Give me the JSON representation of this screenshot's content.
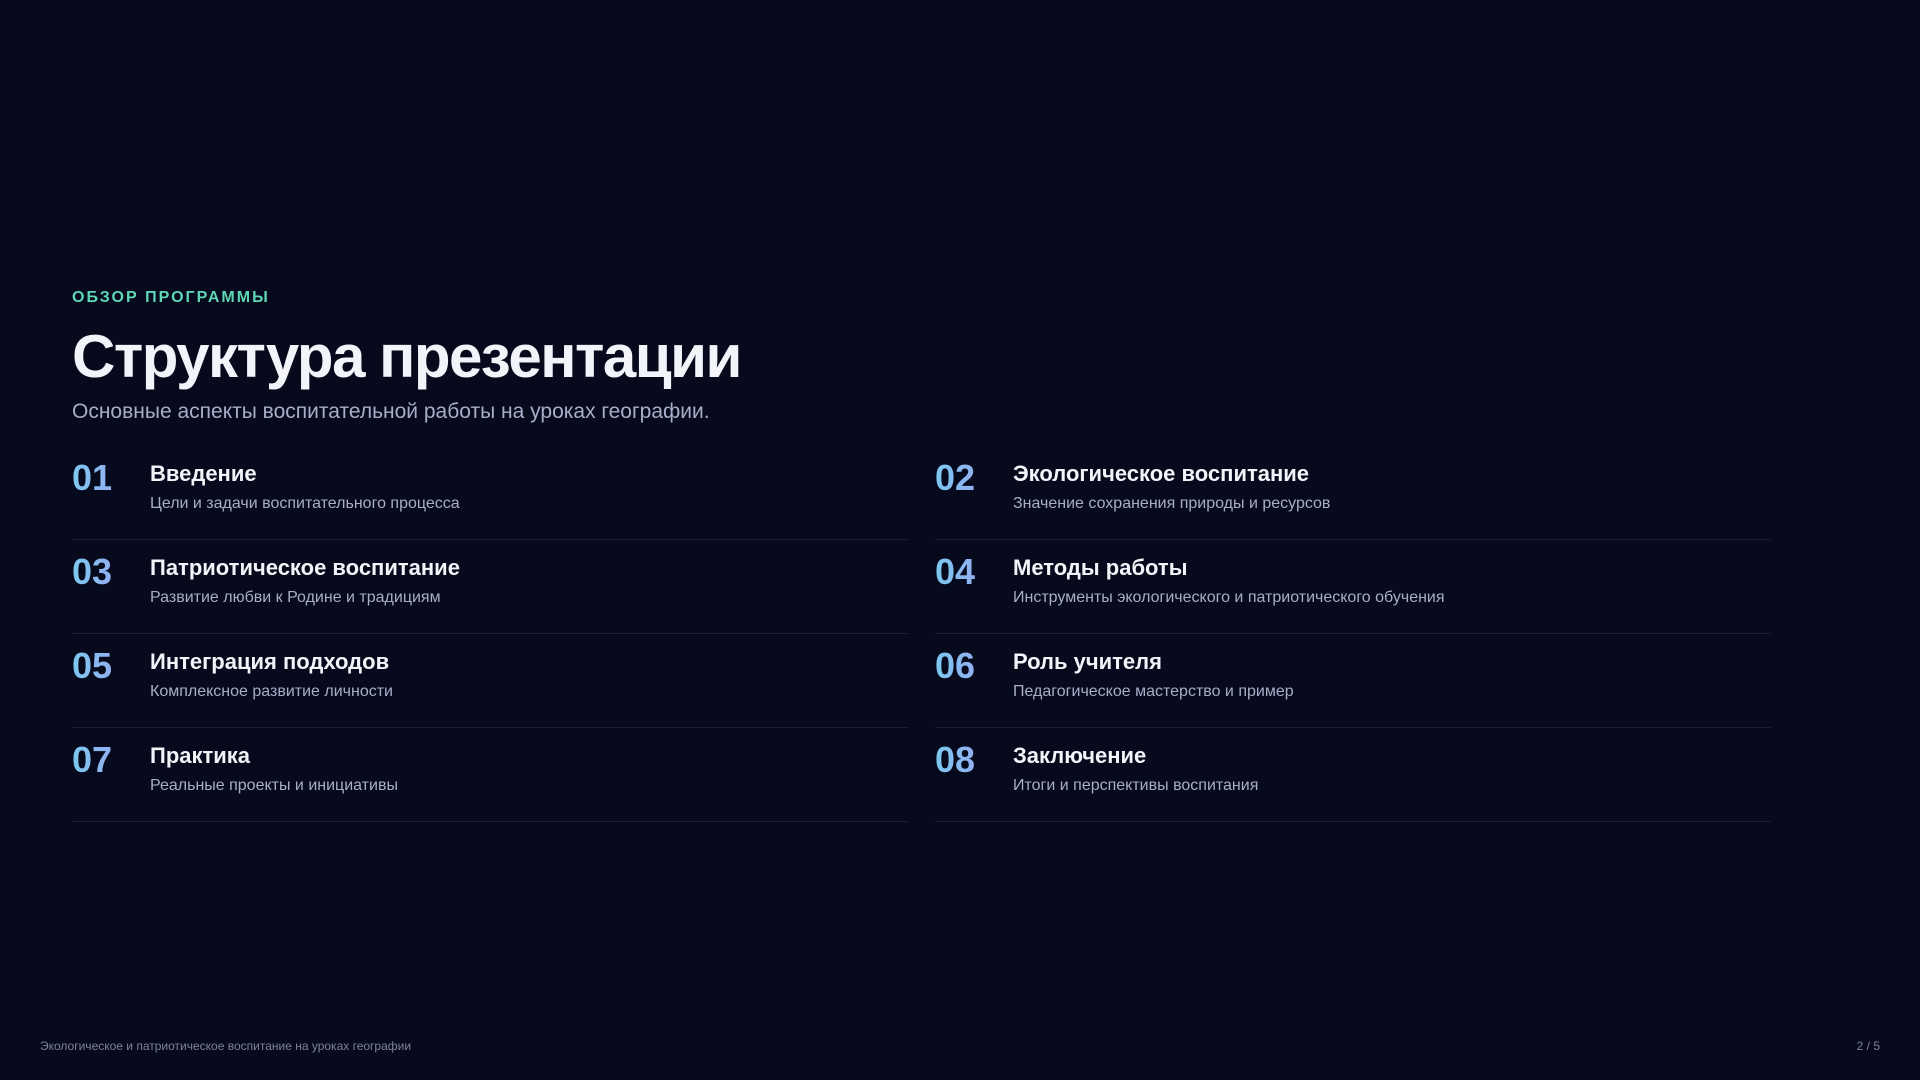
{
  "header": {
    "eyebrow": "ОБЗОР ПРОГРАММЫ",
    "title": "Структура презентации",
    "subtitle": "Основные аспекты воспитательной работы на уроках географии."
  },
  "items": [
    {
      "num": "01",
      "title": "Введение",
      "desc": "Цели и задачи воспитательного процесса"
    },
    {
      "num": "02",
      "title": "Экологическое воспитание",
      "desc": "Значение сохранения природы и ресурсов"
    },
    {
      "num": "03",
      "title": "Патриотическое воспитание",
      "desc": "Развитие любви к Родине и традициям"
    },
    {
      "num": "04",
      "title": "Методы работы",
      "desc": "Инструменты экологического и патриотического обучения"
    },
    {
      "num": "05",
      "title": "Интеграция подходов",
      "desc": "Комплексное развитие личности"
    },
    {
      "num": "06",
      "title": "Роль учителя",
      "desc": "Педагогическое мастерство и пример"
    },
    {
      "num": "07",
      "title": "Практика",
      "desc": "Реальные проекты и инициативы"
    },
    {
      "num": "08",
      "title": "Заключение",
      "desc": "Итоги и перспективы воспитания"
    }
  ],
  "footer": {
    "caption": "Экологическое и патриотическое воспитание на уроках географии",
    "page": "2 / 5"
  },
  "colors": {
    "background": "#070a1c",
    "accent_eyebrow": "#5fd6b4",
    "number_gradient_start": "#7bc8f0",
    "number_gradient_end": "#a79af3",
    "title_text": "#f3f4fa",
    "muted_text": "#a9adc7"
  }
}
